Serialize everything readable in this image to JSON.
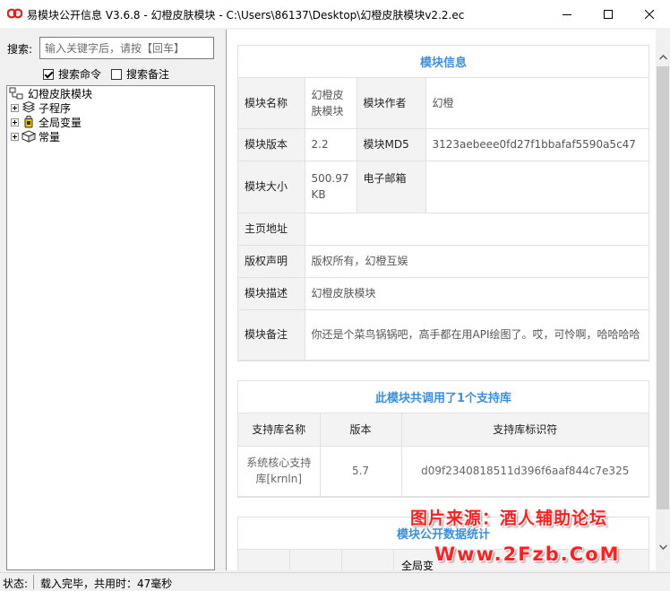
{
  "window": {
    "title": "易模块公开信息 V3.6.8 - 幻橙皮肤模块 - C:\\Users\\86137\\Desktop\\幻橙皮肤模块v2.2.ec",
    "controls": [
      "minimize-icon",
      "maximize-icon",
      "close-icon"
    ]
  },
  "search": {
    "label": "搜索:",
    "placeholder": "输入关键字后，请按【回车】",
    "options": [
      {
        "label": "搜索命令",
        "checked": true
      },
      {
        "label": "搜索备注",
        "checked": false
      }
    ]
  },
  "tree": {
    "root": {
      "label": "幻橙皮肤模块",
      "icon": "module-icon"
    },
    "children": [
      {
        "label": "子程序",
        "icon": "subroutine-icon"
      },
      {
        "label": "全局变量",
        "icon": "global-variable-icon"
      },
      {
        "label": "常量",
        "icon": "constant-icon"
      }
    ]
  },
  "module_info": {
    "title": "模块信息",
    "name_key": "模块名称",
    "name_val": "幻橙皮肤模块",
    "author_key": "模块作者",
    "author_val": "幻橙",
    "version_key": "模块版本",
    "version_val": "2.2",
    "md5_key": "模块MD5",
    "md5_val": "3123aebeee0fd27f1bbafaf5590a5c47",
    "size_key": "模块大小",
    "size_val": "500.97 KB",
    "email_key": "电子邮箱",
    "email_val": "",
    "homepage_key": "主页地址",
    "homepage_val": "",
    "copyright_key": "版权声明",
    "copyright_val": "版权所有，幻橙互娱",
    "desc_key": "模块描述",
    "desc_val": "幻橙皮肤模块",
    "remark_key": "模块备注",
    "remark_val": "你还是个菜鸟锅锅吧，高手都在用API绘图了。哎，可怜啊，哈哈哈哈"
  },
  "libraries": {
    "title": "此模块共调用了1个支持库",
    "headers": [
      "支持库名称",
      "版本",
      "支持库标识符"
    ],
    "rows": [
      {
        "name": "系统核心支持库[krnln]",
        "version": "5.7",
        "id": "d09f2340818511d396f6aaf844c7e325"
      }
    ]
  },
  "stats": {
    "title": "模块公开数据统计",
    "partial_header": "全局变"
  },
  "status": {
    "label": "状态:",
    "text": "载入完毕，共用时：47毫秒"
  },
  "watermark": {
    "line1": "图片来源：酒人辅助论坛",
    "line2": "Www.2Fzb.CoM"
  },
  "colors": {
    "accent": "#3b8fe0",
    "watermark": "#ff1f1f"
  }
}
